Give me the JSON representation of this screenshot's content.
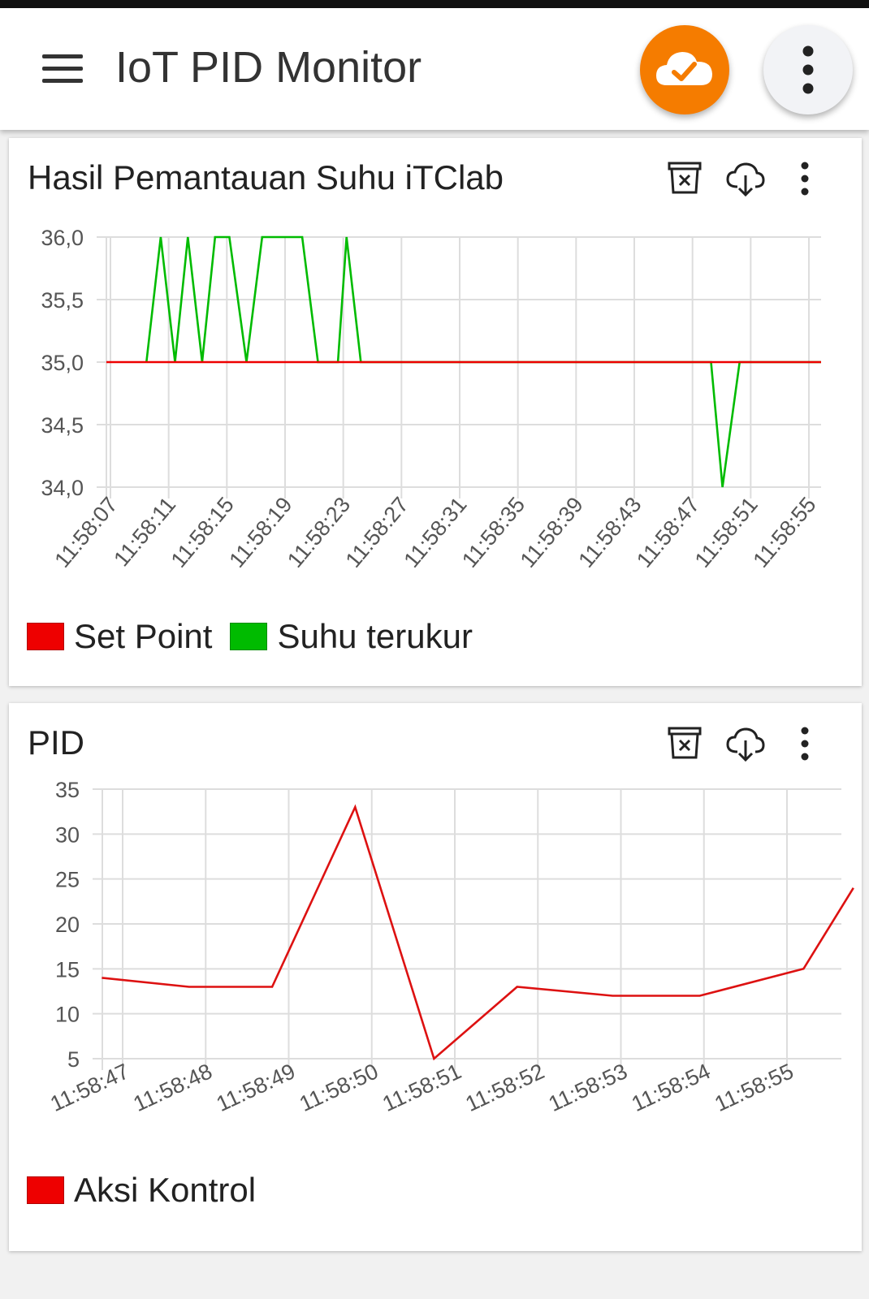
{
  "colors": {
    "set_point": "#ee0000",
    "measured": "#00bb00",
    "control": "#dd1111",
    "accent": "#f57c00",
    "grid": "#dddddd"
  },
  "appbar": {
    "title": "IoT PID Monitor",
    "menu_icon": "hamburger-menu-icon",
    "cloud_icon": "cloud-check-icon",
    "more_icon": "more-vert-icon"
  },
  "card1": {
    "title": "Hasil Pemantauan Suhu iTClab",
    "icons": [
      "clear-data-icon",
      "cloud-download-icon",
      "more-vert-icon"
    ],
    "legend": [
      {
        "label": "Set Point",
        "color": "#ee0000"
      },
      {
        "label": "Suhu terukur",
        "color": "#00bb00"
      }
    ]
  },
  "card2": {
    "title": "PID",
    "icons": [
      "clear-data-icon",
      "cloud-download-icon",
      "more-vert-icon"
    ],
    "legend": [
      {
        "label": "Aksi Kontrol",
        "color": "#ee0000"
      }
    ]
  },
  "chart_data": [
    {
      "type": "line",
      "title": "Hasil Pemantauan Suhu iTClab",
      "x_ticks": [
        "11:58:07",
        "11:58:11",
        "11:58:15",
        "11:58:19",
        "11:58:23",
        "11:58:27",
        "11:58:31",
        "11:58:35",
        "11:58:39",
        "11:58:43",
        "11:58:47",
        "11:58:51",
        "11:58:55"
      ],
      "y_ticks": [
        "36,0",
        "35,5",
        "35,0",
        "34,5",
        "34,0"
      ],
      "ylim": [
        34,
        36
      ],
      "xlim": [
        0,
        50
      ],
      "grid": true,
      "legend_position": "bottom-left",
      "series": [
        {
          "name": "Set Point",
          "color": "#ee0000",
          "points": [
            [
              0,
              35
            ],
            [
              50,
              35
            ]
          ]
        },
        {
          "name": "Suhu terukur",
          "color": "#00bb00",
          "points": [
            [
              2.8,
              35
            ],
            [
              3.8,
              36
            ],
            [
              4.8,
              35
            ],
            [
              5.7,
              36
            ],
            [
              6.7,
              35
            ],
            [
              7.6,
              36
            ],
            [
              8.6,
              36
            ],
            [
              9.8,
              35
            ],
            [
              10.9,
              36
            ],
            [
              13.7,
              36
            ],
            [
              14.8,
              35
            ],
            [
              16.2,
              35
            ],
            [
              16.8,
              36
            ],
            [
              17.8,
              35
            ],
            [
              42.3,
              35
            ],
            [
              43.1,
              34
            ],
            [
              44.3,
              35
            ],
            [
              50,
              35
            ]
          ]
        }
      ]
    },
    {
      "type": "line",
      "title": "PID",
      "x_ticks": [
        "11:58:47",
        "11:58:48",
        "11:58:49",
        "11:58:50",
        "11:58:51",
        "11:58:52",
        "11:58:53",
        "11:58:54",
        "11:58:55"
      ],
      "y_ticks": [
        "35",
        "30",
        "25",
        "20",
        "15",
        "10",
        "5"
      ],
      "ylim": [
        5,
        35
      ],
      "grid": true,
      "legend_position": "bottom-left",
      "series": [
        {
          "name": "Aksi Kontrol",
          "color": "#dd1111",
          "points": [
            [
              -0.25,
              14
            ],
            [
              0.8,
              13
            ],
            [
              1.8,
              13
            ],
            [
              2.8,
              33
            ],
            [
              3.75,
              5
            ],
            [
              4.75,
              13
            ],
            [
              5.9,
              12
            ],
            [
              6.95,
              12
            ],
            [
              8.2,
              15
            ],
            [
              8.8,
              24
            ]
          ]
        }
      ]
    }
  ]
}
